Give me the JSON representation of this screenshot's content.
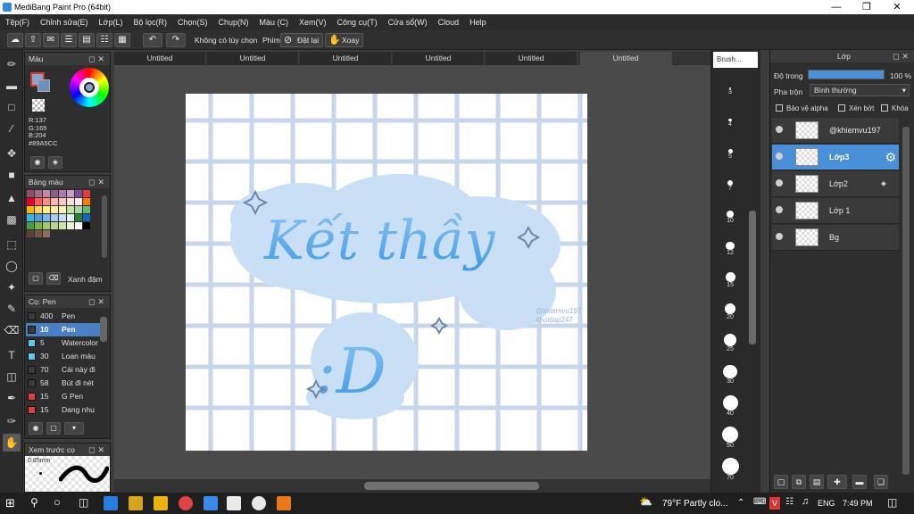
{
  "window": {
    "title": "MediBang Paint Pro (64bit)"
  },
  "menu": [
    "Tệp(F)",
    "Chỉnh sửa(E)",
    "Lớp(L)",
    "Bộ lọc(R)",
    "Chọn(S)",
    "Chụp(N)",
    "Màu (C)",
    "Xem(V)",
    "Công cụ(T)",
    "Cửa sổ(W)",
    "Cloud",
    "Help"
  ],
  "toolbar": {
    "no_option": "Không có tùy chọn",
    "key_label": "Phím",
    "reset_label": "Đặt lại",
    "rotate_label": "Xoay"
  },
  "color_panel": {
    "title": "Màu",
    "r": "R:137",
    "g": "G:165",
    "b": "B:204",
    "hex": "#89A5CC",
    "fg_color": "#89A5CC"
  },
  "palette_panel": {
    "title": "Bảng màu",
    "label": "Xanh đậm",
    "swatches": [
      "#8a4f6b",
      "#a86b86",
      "#c686a5",
      "#8b5e8d",
      "#a97fb0",
      "#c7a0c9",
      "#7b4f9a",
      "#e83a3a",
      "#e4002b",
      "#ff5a5a",
      "#ff8a8a",
      "#ffb3b3",
      "#ffc7c7",
      "#ffdede",
      "#fcecec",
      "#ff7a00",
      "#ffb300",
      "#ffd54d",
      "#fff176",
      "#ffee99",
      "#fff3c4",
      "#c3e59a",
      "#a5d6a7",
      "#66bb6a",
      "#39b6e6",
      "#4f9be0",
      "#7fb6ef",
      "#a7cdf5",
      "#c6e0fa",
      "#e2eefc",
      "#2e7d32",
      "#1565c0",
      "#43a047",
      "#7cb342",
      "#9ccc65",
      "#b7d98b",
      "#cfe3a8",
      "#e9f2d6",
      "#ffffff",
      "#000000",
      "#5d4037",
      "#795548",
      "#8d6e63"
    ]
  },
  "brush_panel": {
    "title": "Cọ: Pen",
    "items": [
      {
        "size": "400",
        "name": "Pen",
        "color": "#3a3a3a"
      },
      {
        "size": "10",
        "name": "Pen",
        "color": "#3a3a3a",
        "selected": true
      },
      {
        "size": "5",
        "name": "Watercolor",
        "color": "#5ac8f0"
      },
      {
        "size": "30",
        "name": "Loan màu",
        "color": "#5ac8f0"
      },
      {
        "size": "70",
        "name": "Cái này đi",
        "color": "#3a3a3a"
      },
      {
        "size": "58",
        "name": "Bút đi nét",
        "color": "#3a3a3a"
      },
      {
        "size": "15",
        "name": "G Pen",
        "color": "#e63c3c"
      },
      {
        "size": "15",
        "name": "Dang nhu",
        "color": "#e63c3c"
      }
    ]
  },
  "preview_panel": {
    "title": "Xem trước cọ",
    "size": "0.85mm"
  },
  "tabs": [
    "Untitled",
    "Untitled",
    "Untitled",
    "Untitled",
    "Untitled",
    "Untitled"
  ],
  "artwork": {
    "line1": "Kết thầy",
    "line2": ":D",
    "watermark1": "@khiemvu197",
    "watermark2": "#hoidap247"
  },
  "brush_sizes": {
    "title": "Brush...",
    "items": [
      "3",
      "4",
      "5",
      "7",
      "10",
      "12",
      "15",
      "20",
      "25",
      "30",
      "40",
      "50",
      "70"
    ]
  },
  "layer_panel": {
    "title": "Lớp",
    "opacity_label": "Độ trong",
    "opacity_value": "100 %",
    "opacity": 1.0,
    "blend_label": "Pha trộn",
    "blend_value": "Bình thường",
    "protect_alpha": "Bảo vệ alpha",
    "clipping": "Xén bớt",
    "lock": "Khóa",
    "layers": [
      {
        "name": "@khiemvu197"
      },
      {
        "name": "Lớp3",
        "selected": true
      },
      {
        "name": "Lớp2"
      },
      {
        "name": "Lớp 1"
      },
      {
        "name": "Bg"
      }
    ]
  },
  "taskbar": {
    "weather": "79°F  Partly clo...",
    "lang": "ENG",
    "time": "7:49 PM"
  }
}
